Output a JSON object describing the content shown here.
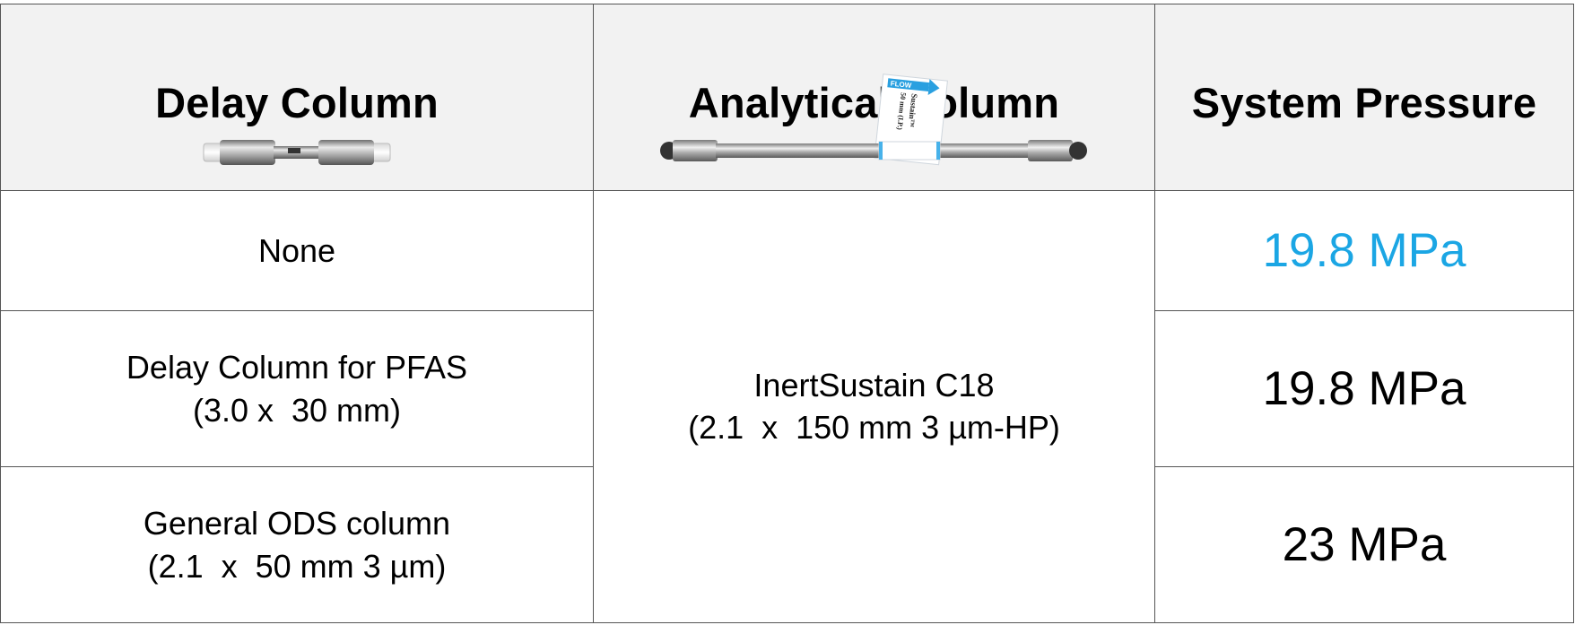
{
  "table": {
    "headers": {
      "delay": "Delay Column",
      "analytical": "Analytical Column",
      "pressure": "System Pressure"
    },
    "images": {
      "delay_image": "delay-column-photo",
      "analytical_image": "analytical-column-photo",
      "analytical_label_text": "FLOW",
      "analytical_label_product": "Sustain™",
      "analytical_label_dims": "50 mm (I.P.)"
    },
    "rows": [
      {
        "delay": [
          "None"
        ],
        "pressure": "19.8 MPa"
      },
      {
        "delay": [
          "Delay Column for PFAS",
          "(3.0 x  30 mm)"
        ],
        "pressure": "19.8 MPa"
      },
      {
        "delay": [
          "General ODS column",
          "(2.1  x  50 mm 3 µm)"
        ],
        "pressure": "23 MPa"
      }
    ],
    "analytical_value": [
      "InertSustain C18",
      "(2.1  x  150 mm 3 µm-HP)"
    ]
  },
  "colors": {
    "header_bg": "#f2f2f2",
    "border": "#555555",
    "highlight_pressure": "#1ba6e4",
    "text": "#000000"
  }
}
